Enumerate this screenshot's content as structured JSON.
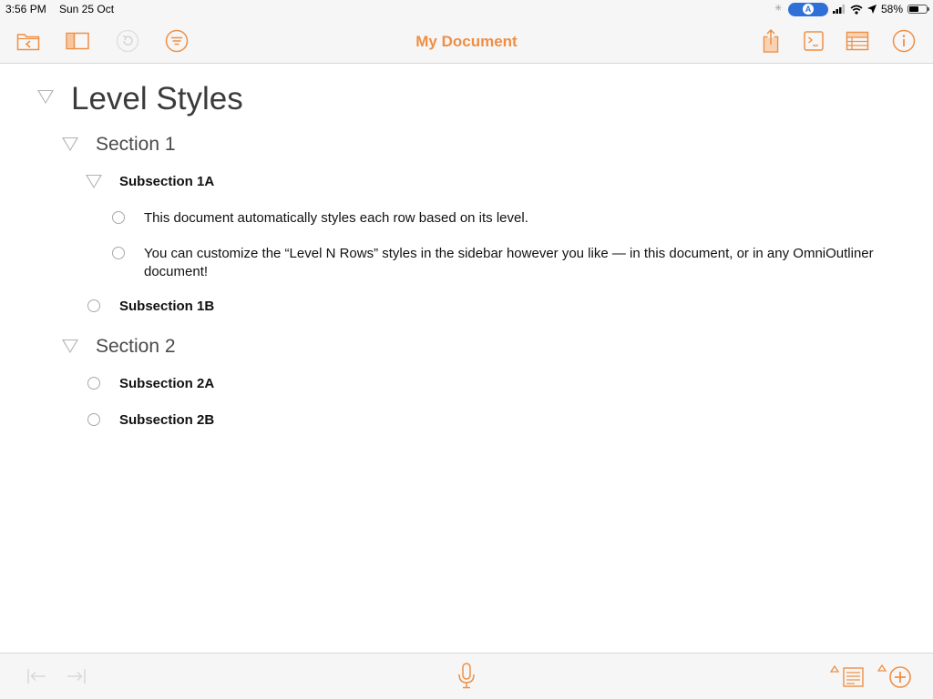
{
  "status_bar": {
    "time": "3:56 PM",
    "date": "Sun 25 Oct",
    "battery_percent": "58%",
    "battery_level": 0.58
  },
  "toolbar": {
    "title": "My Document",
    "accent_color": "#ef8f45",
    "left_icons": [
      "documents-back-icon",
      "sidebar-icon",
      "undo-icon",
      "filter-icon"
    ],
    "right_icons": [
      "share-icon",
      "console-icon",
      "columns-icon",
      "info-icon"
    ]
  },
  "outline": {
    "title": "Level Styles",
    "section1": "Section 1",
    "subsection1a": "Subsection 1A",
    "row1": "This document automatically styles each row based on its level.",
    "row2": "You can customize the “Level N Rows” styles in the sidebar however you like — in this document, or in any OmniOutliner document!",
    "subsection1b": "Subsection 1B",
    "section2": "Section 2",
    "subsection2a": "Subsection 2A",
    "subsection2b": "Subsection 2B"
  },
  "bottom_bar": {
    "icons": [
      "outdent-icon",
      "indent-icon",
      "microphone-icon",
      "add-note-icon",
      "add-row-icon"
    ]
  }
}
